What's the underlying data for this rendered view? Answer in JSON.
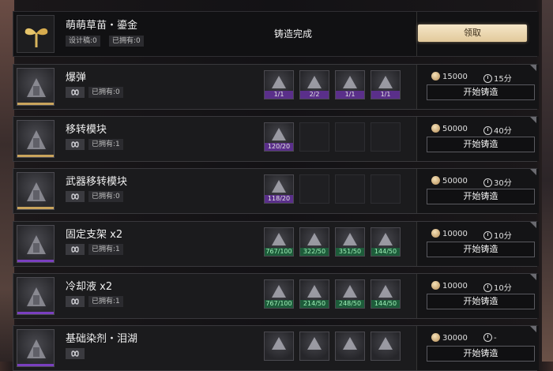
{
  "featured": {
    "name": "萌萌草苗・鎏金",
    "design_chip": "设计稿:0",
    "owned_chip": "已拥有:0",
    "status": "铸造完成",
    "claim_label": "领取"
  },
  "rows": [
    {
      "name": "爆弹",
      "owned": "已拥有:0",
      "materials": [
        {
          "count": "1/1",
          "style": "rare"
        },
        {
          "count": "2/2",
          "style": "rare"
        },
        {
          "count": "1/1",
          "style": "rare"
        },
        {
          "count": "1/1",
          "style": "rare"
        }
      ],
      "cost": "15000",
      "time": "15分",
      "button": "开始铸造"
    },
    {
      "name": "移转模块",
      "owned": "已拥有:1",
      "materials": [
        {
          "count": "120/20",
          "style": "rare"
        }
      ],
      "cost": "50000",
      "time": "40分",
      "button": "开始铸造"
    },
    {
      "name": "武器移转模块",
      "owned": "已拥有:0",
      "materials": [
        {
          "count": "118/20",
          "style": "rare"
        }
      ],
      "cost": "50000",
      "time": "30分",
      "button": "开始铸造"
    },
    {
      "name": "固定支架 x2",
      "owned": "已拥有:1",
      "materials": [
        {
          "count": "767/100",
          "style": "green"
        },
        {
          "count": "322/50",
          "style": "green"
        },
        {
          "count": "351/50",
          "style": "green"
        },
        {
          "count": "144/50",
          "style": "green"
        }
      ],
      "cost": "10000",
      "time": "10分",
      "button": "开始铸造"
    },
    {
      "name": "冷却液 x2",
      "owned": "已拥有:1",
      "materials": [
        {
          "count": "767/100",
          "style": "green"
        },
        {
          "count": "214/50",
          "style": "green"
        },
        {
          "count": "248/50",
          "style": "green"
        },
        {
          "count": "144/50",
          "style": "green"
        }
      ],
      "cost": "10000",
      "time": "10分",
      "button": "开始铸造"
    },
    {
      "name": "基础染剂・泪湖",
      "owned": "",
      "materials": [
        {
          "count": "",
          "style": "rare"
        },
        {
          "count": "",
          "style": "rare"
        },
        {
          "count": "",
          "style": "rare"
        },
        {
          "count": "",
          "style": "rare"
        }
      ],
      "cost": "30000",
      "time": "-",
      "button": "开始铸造"
    }
  ],
  "colors": {
    "rare": "#5a2f8a",
    "green": "#1d5c3a",
    "gold_button": "#ecd6ad",
    "legendary_bar": "#c9a45c",
    "epic_bar": "#7a3fc0"
  },
  "icons": {
    "coin": "coin-icon",
    "clock": "clock-icon",
    "infinite": "infinity-icon"
  }
}
